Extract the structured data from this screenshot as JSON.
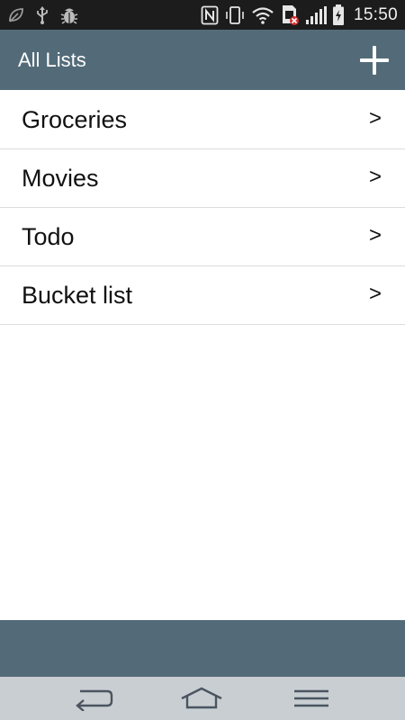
{
  "status_bar": {
    "time": "15:50",
    "left_icons": [
      "leaf-icon",
      "usb-icon",
      "bug-icon"
    ],
    "right_icons": [
      "nfc-icon",
      "vibrate-icon",
      "wifi-icon",
      "sim-error-icon",
      "signal-icon",
      "battery-charging-icon"
    ]
  },
  "app_bar": {
    "title": "All Lists",
    "add_icon": "plus-icon"
  },
  "lists": [
    {
      "label": "Groceries",
      "chevron": ">"
    },
    {
      "label": "Movies",
      "chevron": ">"
    },
    {
      "label": "Todo",
      "chevron": ">"
    },
    {
      "label": "Bucket list",
      "chevron": ">"
    }
  ],
  "nav_bar": {
    "buttons": [
      "back-icon",
      "home-icon",
      "menu-icon"
    ]
  },
  "colors": {
    "status_bar_bg": "#1c1c1c",
    "app_bar_bg": "#536b78",
    "nav_bar_bg": "#c9ced2",
    "divider": "#dcdcdc"
  }
}
